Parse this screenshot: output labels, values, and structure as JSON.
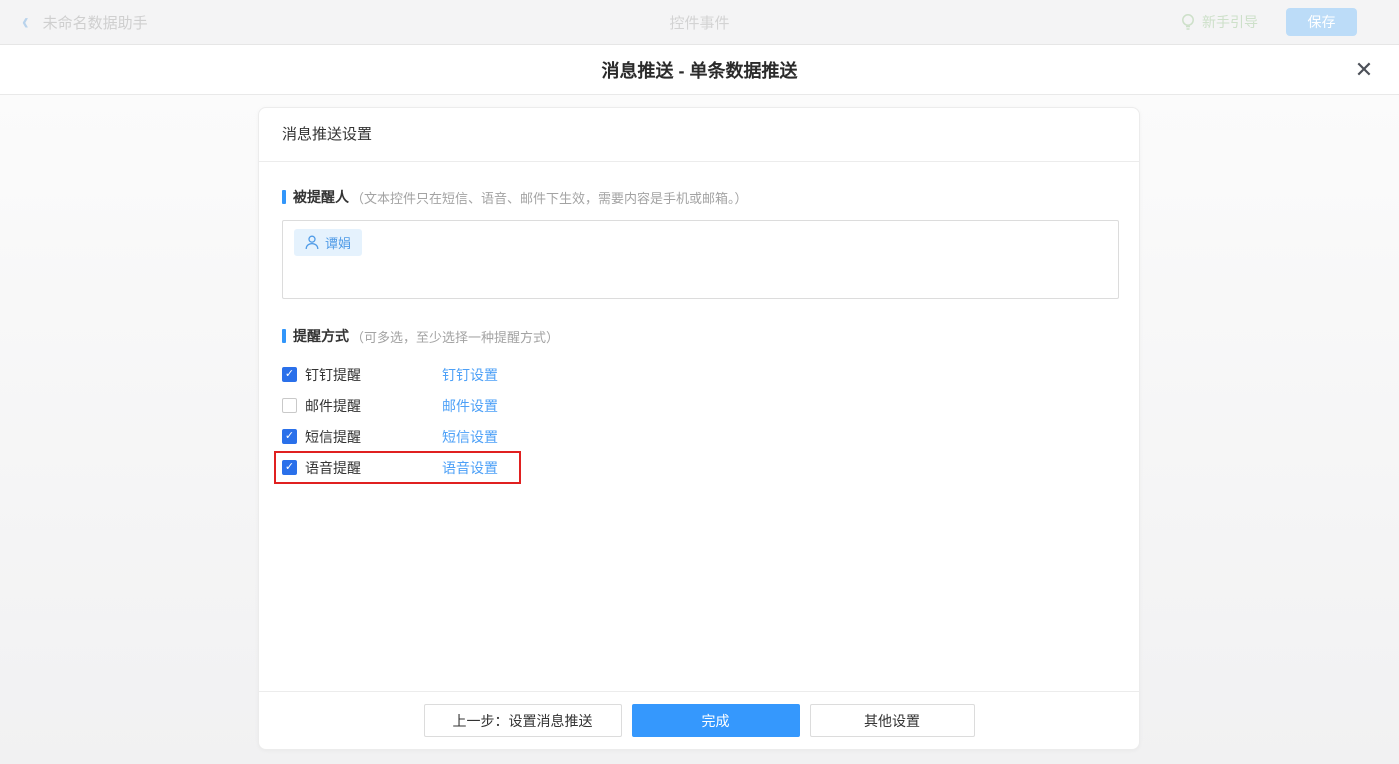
{
  "topbar": {
    "back_title": "未命名数据助手",
    "center_title": "控件事件",
    "guide_label": "新手引导",
    "save_label": "保存"
  },
  "modal": {
    "title": "消息推送 - 单条数据推送",
    "card": {
      "header": "消息推送设置",
      "recipients": {
        "label": "被提醒人",
        "note": "（文本控件只在短信、语音、邮件下生效，需要内容是手机或邮箱。）",
        "chips": [
          {
            "name": "谭娟"
          }
        ]
      },
      "methods": {
        "label": "提醒方式",
        "note": "（可多选，至少选择一种提醒方式）",
        "rows": [
          {
            "label": "钉钉提醒",
            "link": "钉钉设置",
            "checked": true,
            "highlighted": false
          },
          {
            "label": "邮件提醒",
            "link": "邮件设置",
            "checked": false,
            "highlighted": false
          },
          {
            "label": "短信提醒",
            "link": "短信设置",
            "checked": true,
            "highlighted": false
          },
          {
            "label": "语音提醒",
            "link": "语音设置",
            "checked": true,
            "highlighted": true
          }
        ]
      },
      "footer": {
        "prev_label": "上一步：设置消息推送",
        "done_label": "完成",
        "other_label": "其他设置"
      }
    }
  },
  "icons": {
    "back": "chevron-left-icon",
    "guide": "lightbulb-icon",
    "close": "close-icon",
    "person": "person-icon",
    "check": "✓"
  },
  "colors": {
    "accent_blue": "#3598fd",
    "link_blue": "#4da0f7",
    "checkbox_blue": "#2a70ea",
    "section_bar_blue": "#3296fa",
    "chip_bg": "#e5f2fd",
    "chip_text": "#4f9be7",
    "highlight_red": "#e02020",
    "topbar_bg": "#f4f4f5",
    "disabled_save_bg": "#bcdcf8",
    "guide_green": "#cde0c9"
  }
}
